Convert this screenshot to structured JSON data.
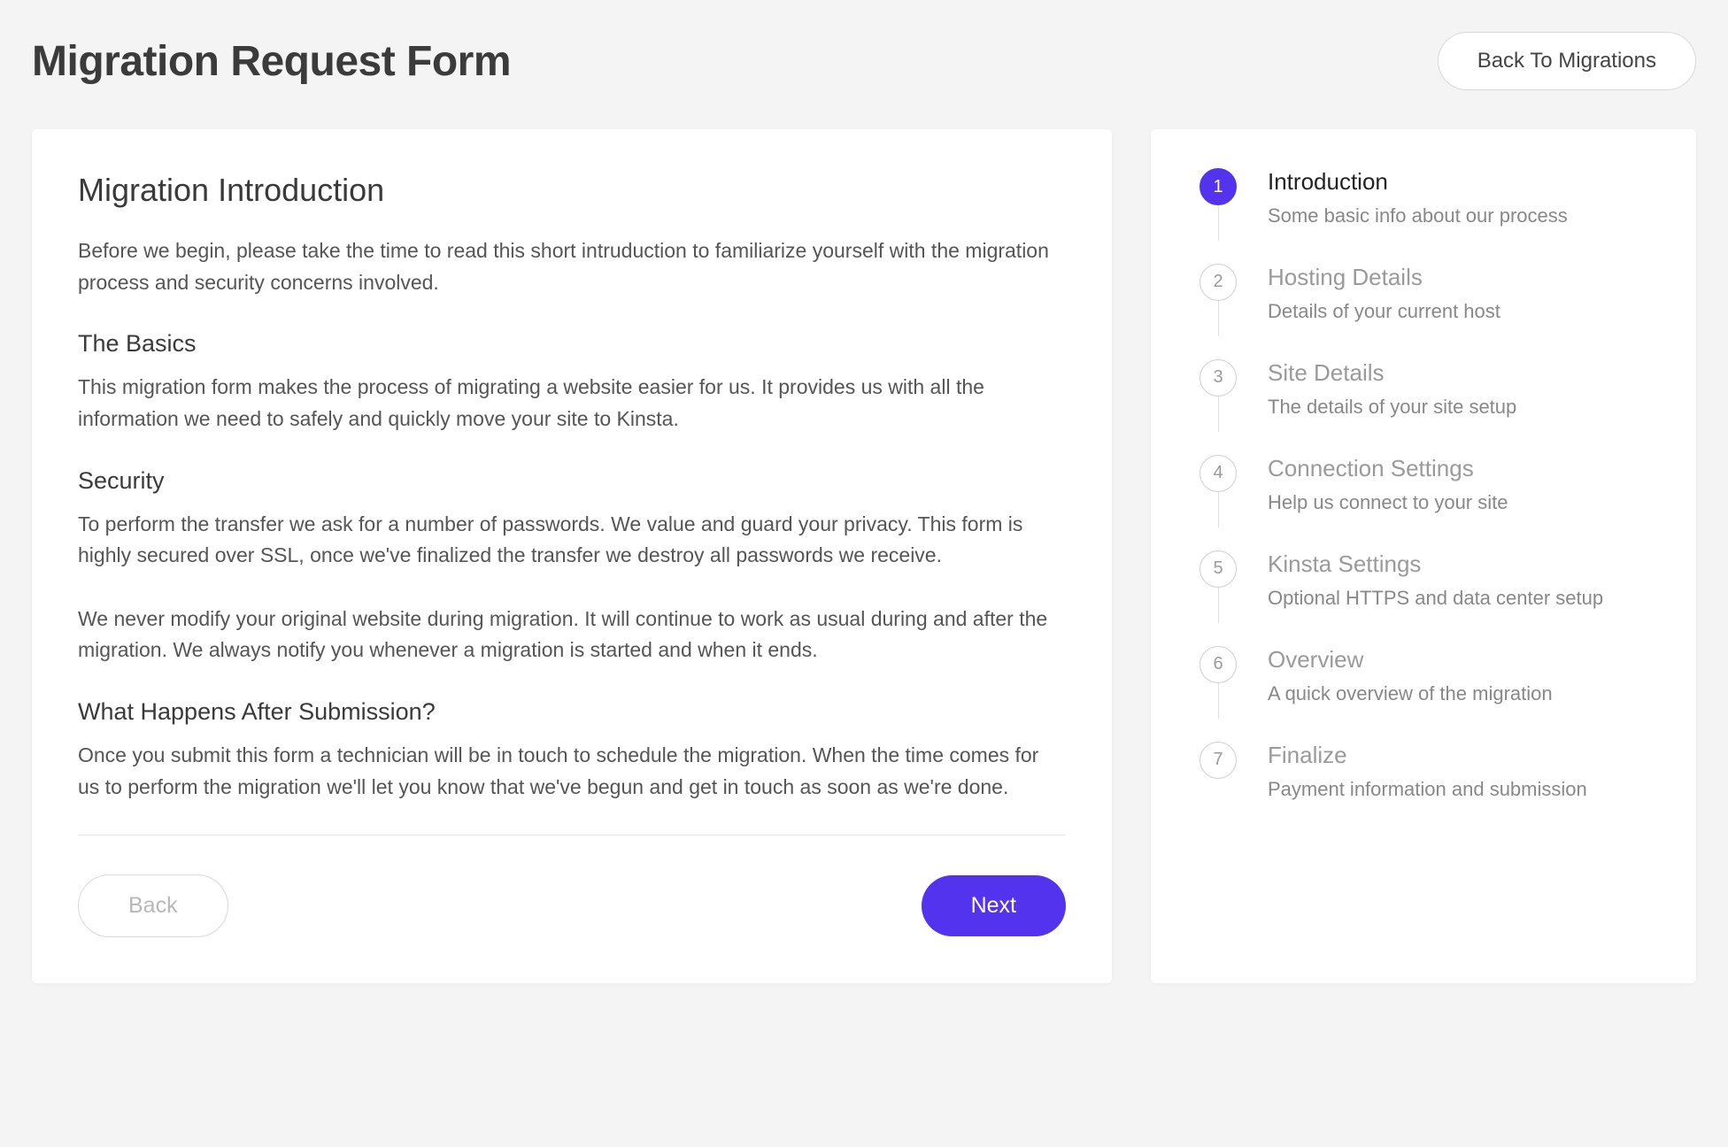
{
  "header": {
    "title": "Migration Request Form",
    "back_button": "Back To Migrations"
  },
  "main": {
    "title": "Migration Introduction",
    "intro": "Before we begin, please take the time to read this short intruduction to familiarize yourself with the migration process and security concerns involved.",
    "basics_heading": "The Basics",
    "basics_body": "This migration form makes the process of migrating a website easier for us. It provides us with all the information we need to safely and quickly move your site to Kinsta.",
    "security_heading": "Security",
    "security_body_1": "To perform the transfer we ask for a number of passwords. We value and guard your privacy. This form is highly secured over SSL, once we've finalized the transfer we destroy all passwords we receive.",
    "security_body_2": "We never modify your original website during migration. It will continue to work as usual during and after the migration. We always notify you whenever a migration is started and when it ends.",
    "after_heading": "What Happens After Submission?",
    "after_body": "Once you submit this form a technician will be in touch to schedule the migration. When the time comes for us to perform the migration we'll let you know that we've begun and get in touch as soon as we're done.",
    "back_label": "Back",
    "next_label": "Next"
  },
  "steps": [
    {
      "num": "1",
      "title": "Introduction",
      "desc": "Some basic info about our process",
      "active": true
    },
    {
      "num": "2",
      "title": "Hosting Details",
      "desc": "Details of your current host",
      "active": false
    },
    {
      "num": "3",
      "title": "Site Details",
      "desc": "The details of your site setup",
      "active": false
    },
    {
      "num": "4",
      "title": "Connection Settings",
      "desc": "Help us connect to your site",
      "active": false
    },
    {
      "num": "5",
      "title": "Kinsta Settings",
      "desc": "Optional HTTPS and data center setup",
      "active": false
    },
    {
      "num": "6",
      "title": "Overview",
      "desc": "A quick overview of the migration",
      "active": false
    },
    {
      "num": "7",
      "title": "Finalize",
      "desc": "Payment information and submission",
      "active": false
    }
  ]
}
